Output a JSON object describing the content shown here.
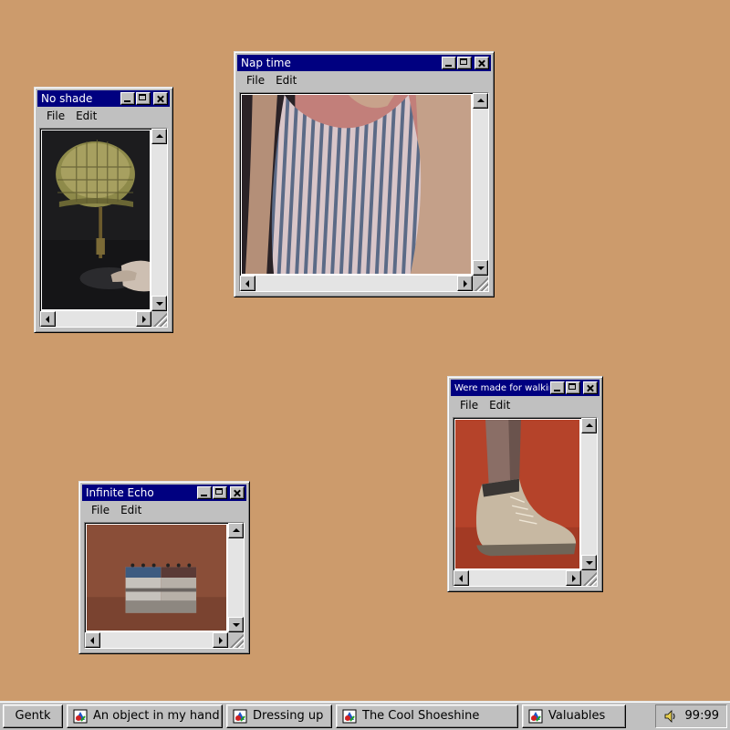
{
  "windows": [
    {
      "id": "no-shade",
      "title": "No shade",
      "menus": [
        "File",
        "Edit"
      ],
      "image": "lamp-photo"
    },
    {
      "id": "nap-time",
      "title": "Nap time",
      "menus": [
        "File",
        "Edit"
      ],
      "image": "striped-top-photo"
    },
    {
      "id": "walking",
      "title": "Were made for walking",
      "menus": [
        "File",
        "Edit"
      ],
      "image": "boot-photo"
    },
    {
      "id": "infinite-echo",
      "title": "Infinite Echo",
      "menus": [
        "File",
        "Edit"
      ],
      "image": "pedals-photo"
    }
  ],
  "taskbar": {
    "start_label": "Gentk",
    "tasks": [
      {
        "label": "An object in my hand",
        "icon": "app-icon"
      },
      {
        "label": "Dressing up",
        "icon": "app-icon"
      },
      {
        "label": "The Cool Shoeshine",
        "icon": "app-icon"
      },
      {
        "label": "Valuables",
        "icon": "app-icon"
      }
    ],
    "tray": {
      "icon": "speaker-icon",
      "clock": "99:99"
    }
  },
  "colors": {
    "desktop": "#cc9b6c",
    "titlebar": "#000080",
    "chrome": "#c0c0c0"
  }
}
